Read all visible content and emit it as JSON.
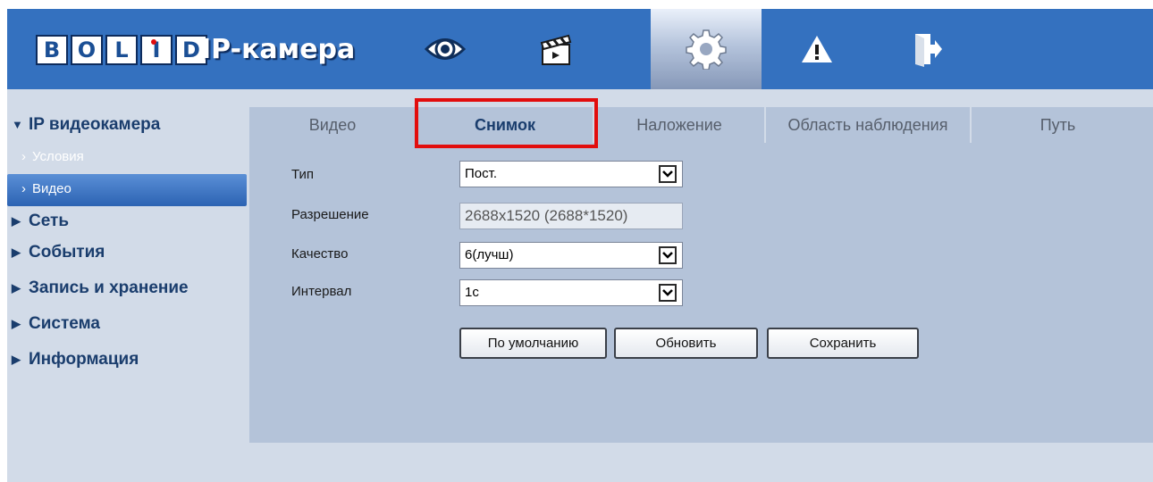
{
  "brand": {
    "logo_text": "BOLID",
    "app_title": "IP-камера"
  },
  "topnav": {
    "items": [
      {
        "icon": "eye-icon"
      },
      {
        "icon": "clapperboard-icon"
      },
      {
        "icon": "gear-icon",
        "active": true
      },
      {
        "icon": "warning-icon"
      },
      {
        "icon": "logout-icon"
      }
    ]
  },
  "sidebar": {
    "items": [
      {
        "label": "IP видеокамера",
        "expanded": true
      },
      {
        "label": "Условия"
      },
      {
        "label": "Видео",
        "active": true
      },
      {
        "label": "Сеть"
      },
      {
        "label": "События"
      },
      {
        "label": "Запись и хранение"
      },
      {
        "label": "Система"
      },
      {
        "label": "Информация"
      }
    ]
  },
  "tabs": {
    "items": [
      {
        "label": "Видео"
      },
      {
        "label": "Снимок",
        "active": true
      },
      {
        "label": "Наложение"
      },
      {
        "label": "Область наблюдения"
      },
      {
        "label": "Путь"
      }
    ]
  },
  "form": {
    "type_label": "Тип",
    "type_value": "Пост.",
    "resolution_label": "Разрешение",
    "resolution_value": "2688x1520 (2688*1520)",
    "quality_label": "Качество",
    "quality_value": "6(лучш)",
    "interval_label": "Интервал",
    "interval_value": "1с"
  },
  "buttons": {
    "default_label": "По умолчанию",
    "refresh_label": "Обновить",
    "save_label": "Сохранить"
  },
  "colors": {
    "header_bg": "#3471bf",
    "accent_highlight": "#e20d0d",
    "panel_bg": "#b4c3d9"
  }
}
